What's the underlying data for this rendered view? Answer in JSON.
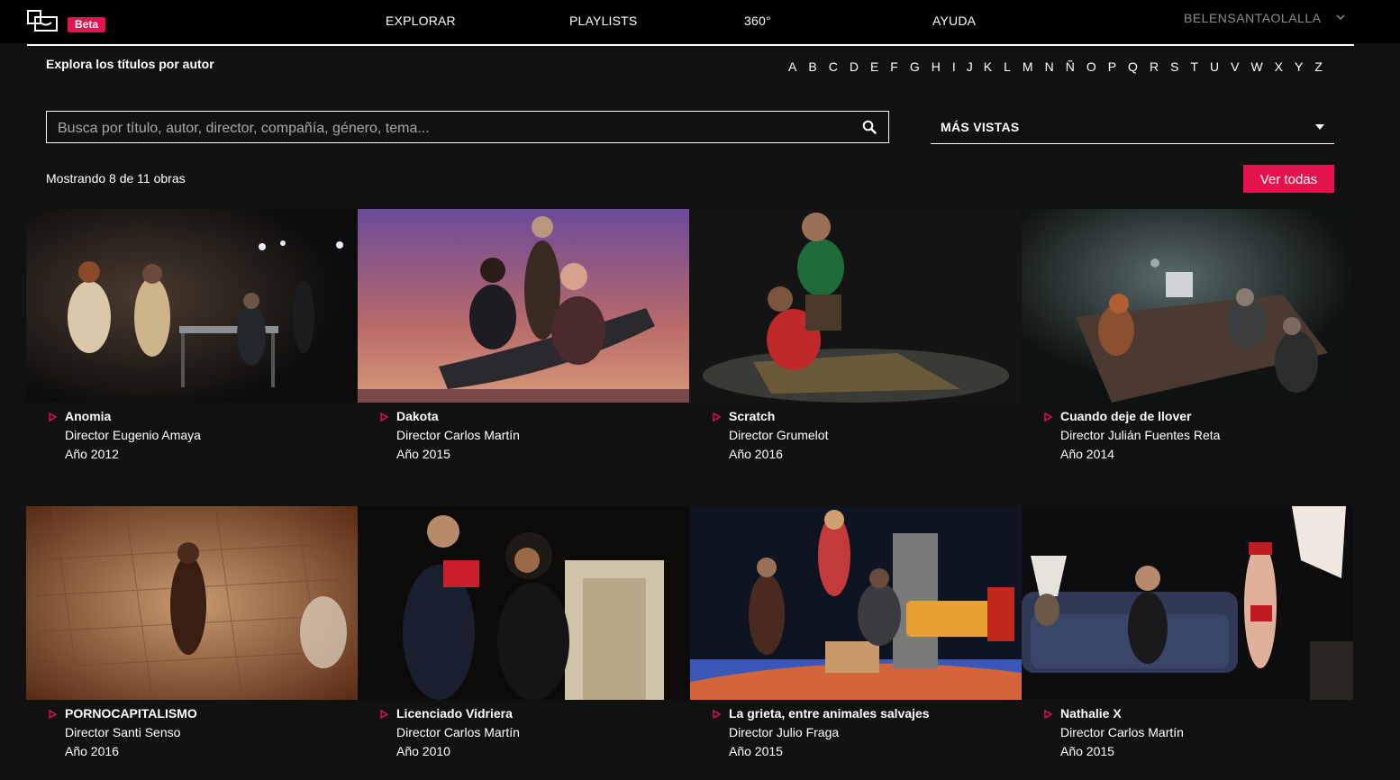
{
  "header": {
    "beta": "Beta",
    "nav": [
      "EXPLORAR",
      "PLAYLISTS",
      "360°",
      "AYUDA"
    ],
    "user": "BELENSANTAOLALLA"
  },
  "filter": {
    "explore_label": "Explora los títulos por autor",
    "letters": [
      "A",
      "B",
      "C",
      "D",
      "E",
      "F",
      "G",
      "H",
      "I",
      "J",
      "K",
      "L",
      "M",
      "N",
      "Ñ",
      "O",
      "P",
      "Q",
      "R",
      "S",
      "T",
      "U",
      "V",
      "W",
      "X",
      "Y",
      "Z"
    ]
  },
  "search": {
    "placeholder": "Busca por título, autor, director, compañía, género, tema..."
  },
  "sort": {
    "label": "MÁS VISTAS"
  },
  "results": {
    "showing": "Mostrando 8 de 11 obras",
    "see_all": "Ver todas"
  },
  "works": [
    {
      "title": "Anomia",
      "director": "Director Eugenio Amaya",
      "year": "Año 2012"
    },
    {
      "title": "Dakota",
      "director": "Director Carlos Martín",
      "year": "Año 2015"
    },
    {
      "title": "Scratch",
      "director": "Director Grumelot",
      "year": "Año 2016"
    },
    {
      "title": "Cuando deje de llover",
      "director": "Director Julián Fuentes Reta",
      "year": "Año 2014"
    },
    {
      "title": "PORNOCAPITALISMO",
      "director": "Director Santi Senso",
      "year": "Año 2016"
    },
    {
      "title": "Licenciado Vidriera",
      "director": "Director Carlos Martín",
      "year": "Año 2010"
    },
    {
      "title": "La grieta, entre animales salvajes",
      "director": "Director Julio Fraga",
      "year": "Año 2015"
    },
    {
      "title": "Nathalie X",
      "director": "Director Carlos Martín",
      "year": "Año 2015"
    }
  ],
  "colors": {
    "accent": "#e4134f",
    "background": "#111111",
    "topbar": "#000000"
  }
}
